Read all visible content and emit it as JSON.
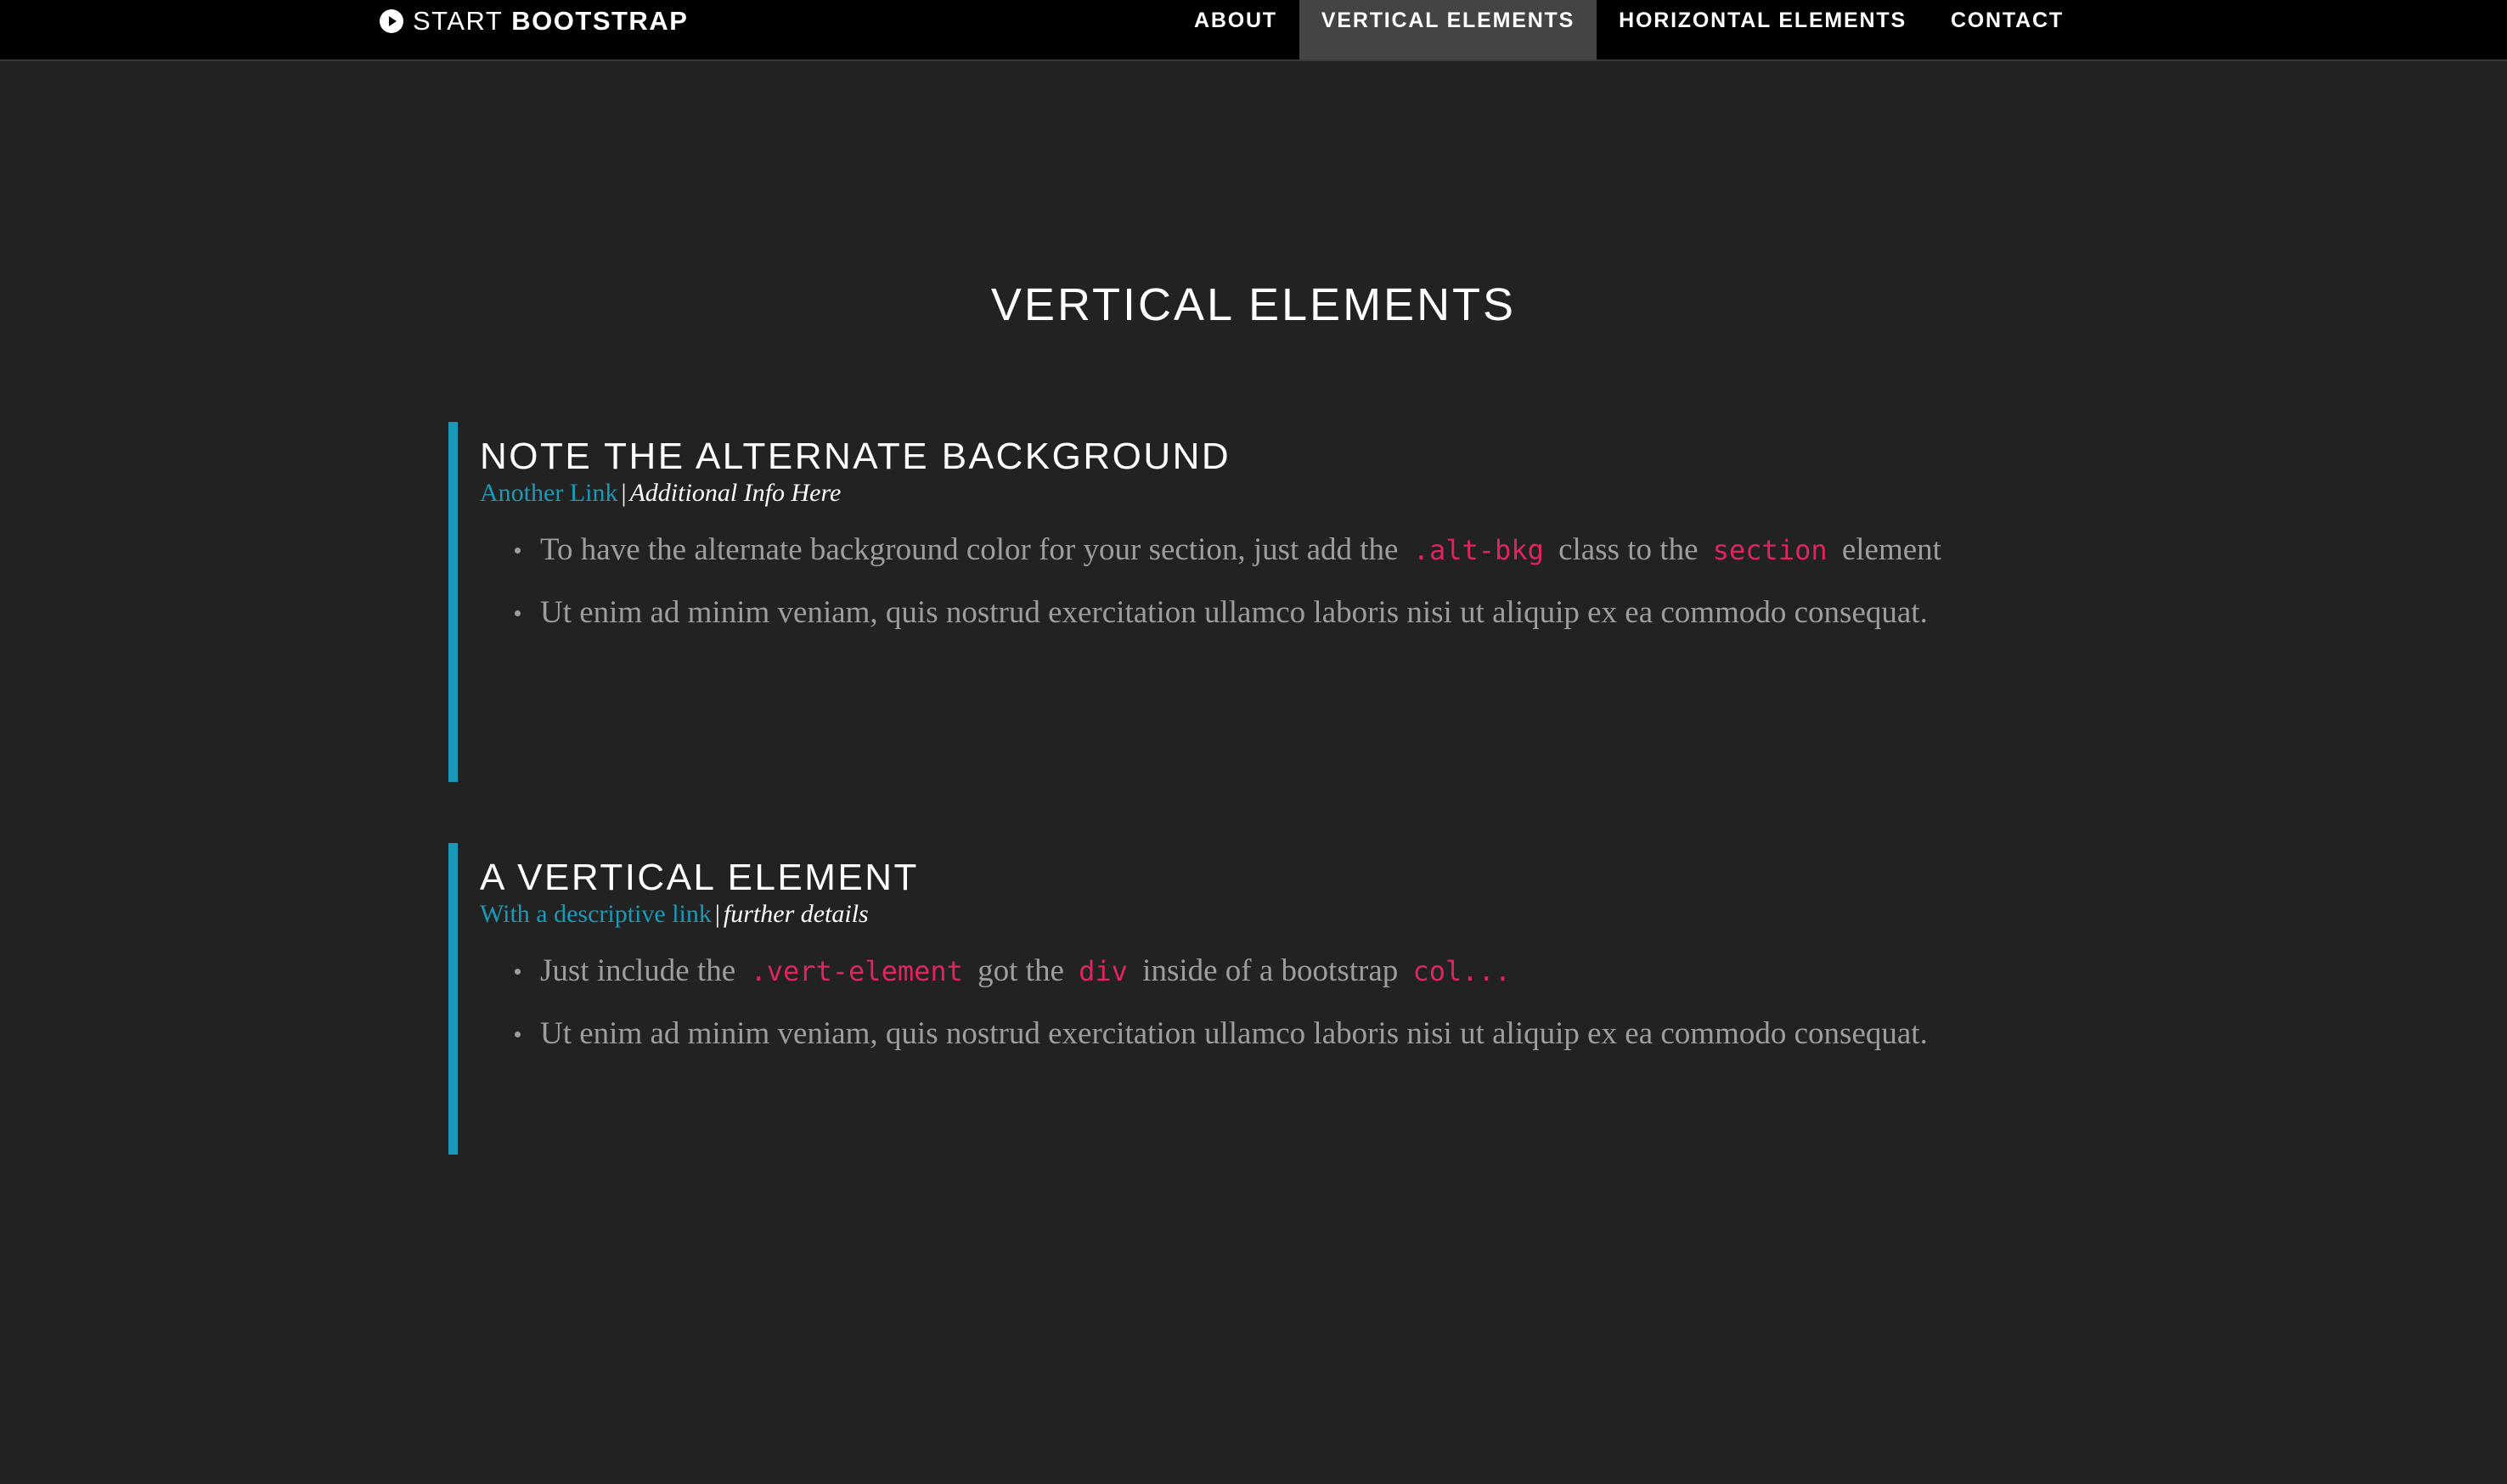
{
  "navbar": {
    "brand_light": "START",
    "brand_bold": "BOOTSTRAP",
    "brand_icon": "play-circle-icon",
    "items": [
      {
        "label": "ABOUT",
        "active": false
      },
      {
        "label": "VERTICAL ELEMENTS",
        "active": true
      },
      {
        "label": "HORIZONTAL ELEMENTS",
        "active": false
      },
      {
        "label": "CONTACT",
        "active": false
      }
    ]
  },
  "section": {
    "title": "VERTICAL ELEMENTS",
    "elements": [
      {
        "title": "NOTE THE ALTERNATE BACKGROUND",
        "link": "Another Link",
        "separator": "|",
        "info": "Additional Info Here",
        "bullets": [
          {
            "parts": [
              {
                "text": "To have the alternate background color for your section, just add the "
              },
              {
                "code": ".alt-bkg"
              },
              {
                "text": " class to the "
              },
              {
                "code": "section"
              },
              {
                "text": " element"
              }
            ]
          },
          {
            "parts": [
              {
                "text": "Ut enim ad minim veniam, quis nostrud exercitation ullamco laboris nisi ut aliquip ex ea commodo consequat."
              }
            ]
          }
        ]
      },
      {
        "title": "A VERTICAL ELEMENT",
        "link": "With a descriptive link",
        "separator": "|",
        "info": "further details",
        "bullets": [
          {
            "parts": [
              {
                "text": "Just include the "
              },
              {
                "code": ".vert-element"
              },
              {
                "text": " got the "
              },
              {
                "code": "div"
              },
              {
                "text": " inside of a bootstrap "
              },
              {
                "code": "col..."
              }
            ]
          },
          {
            "parts": [
              {
                "text": "Ut enim ad minim veniam, quis nostrud exercitation ullamco laboris nisi ut aliquip ex ea commodo consequat."
              }
            ]
          }
        ]
      }
    ]
  },
  "colors": {
    "background": "#222222",
    "navbar": "#000000",
    "nav_active": "#444444",
    "accent": "#1a9ab8",
    "code": "#e0245e",
    "body_text": "#9d9d9d"
  }
}
